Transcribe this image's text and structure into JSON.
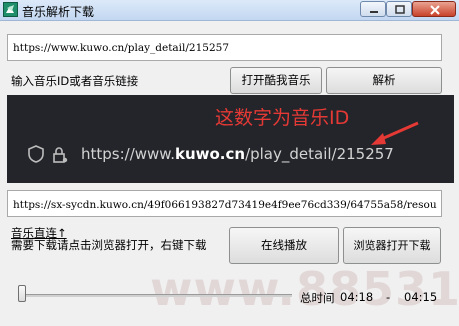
{
  "window": {
    "title": "音乐解析下载"
  },
  "url_input": {
    "value": "https://www.kuwo.cn/play_detail/215257"
  },
  "input_label": "输入音乐ID或者音乐链接",
  "buttons": {
    "open_kuwo": "打开酷我音乐",
    "parse": "解析",
    "play_online": "在线播放",
    "open_in_browser": "浏览器打开下载"
  },
  "hint_image": {
    "caption": "这数字为音乐ID",
    "url_prefix": "https://www.",
    "url_domain": "kuwo.cn",
    "url_path": "/play_detail/215257"
  },
  "stream_url": {
    "value": "https://sx-sycdn.kuwo.cn/49f066193827d73419e4f9ee76cd339/64755a58/resou"
  },
  "help": {
    "line1": "音乐直连↑",
    "line2": "需要下载请点击浏览器打开，右键下载"
  },
  "player": {
    "progress": 0,
    "total_label": "总时间",
    "current_time": "04:18",
    "separator": "-",
    "total_time": "04:15"
  },
  "watermark": "www.88531.cn",
  "colors": {
    "caption_red": "#e53935",
    "hint_bg": "#23252a"
  }
}
